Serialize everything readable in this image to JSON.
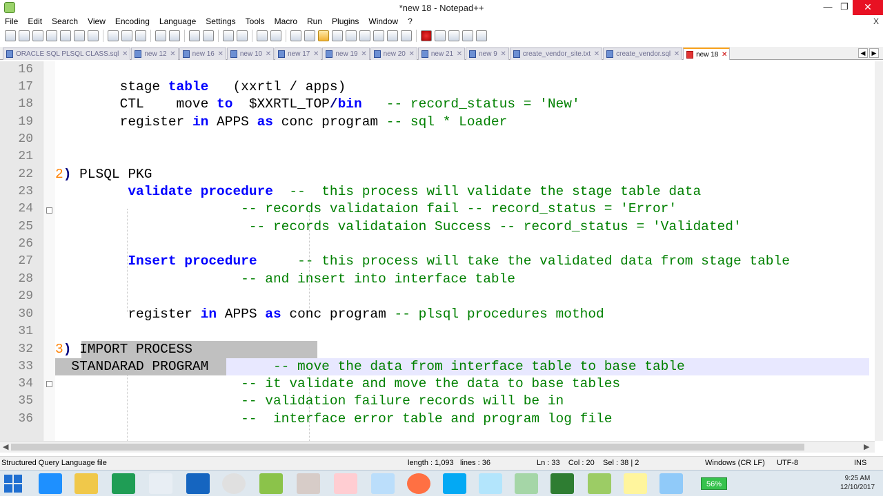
{
  "window": {
    "title": "*new 18 - Notepad++",
    "min": "—",
    "max": "❐",
    "close": "✕"
  },
  "menu": {
    "items": [
      "File",
      "Edit",
      "Search",
      "View",
      "Encoding",
      "Language",
      "Settings",
      "Tools",
      "Macro",
      "Run",
      "Plugins",
      "Window",
      "?"
    ],
    "close_x": "X"
  },
  "tabs": [
    "ORACLE SQL PLSQL CLASS.sql",
    "new 12",
    "new 16",
    "new 10",
    "new 17",
    "new 19",
    "new 20",
    "new 21",
    "new 9",
    "create_vendor_site.txt",
    "create_vendor.sql",
    "new 18"
  ],
  "active_tab": "new 18",
  "tab_close": "✕",
  "tabnav": [
    "◀",
    "▶",
    "✕"
  ],
  "editor": {
    "line_numbers": [
      "16",
      "17",
      "18",
      "19",
      "20",
      "21",
      "22",
      "23",
      "24",
      "25",
      "26",
      "27",
      "28",
      "29",
      "30",
      "31",
      "32",
      "33",
      "34",
      "35",
      "36"
    ],
    "current_line": "33"
  },
  "status": {
    "file_type": "Structured Query Language file",
    "length": "length : 1,093",
    "lines": "lines : 36",
    "position": "Ln : 33    Col : 20    Sel : 38 | 2",
    "eol": "Windows (CR LF)",
    "encoding": "UTF-8",
    "mode": "INS"
  },
  "taskbar": {
    "battery": "56%",
    "time": "9:25 AM",
    "date": "12/10/2017"
  }
}
